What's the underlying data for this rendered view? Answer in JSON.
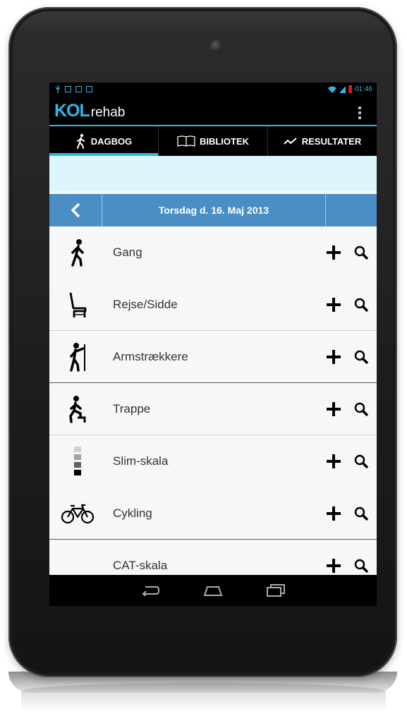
{
  "status_bar": {
    "time": "01:46"
  },
  "app": {
    "logo_primary": "KOL",
    "logo_secondary": "rehab"
  },
  "tabs": [
    {
      "label": "DAGBOG",
      "icon": "walking-person-icon",
      "active": true
    },
    {
      "label": "BIBLIOTEK",
      "icon": "book-icon",
      "active": false
    },
    {
      "label": "RESULTATER",
      "icon": "trend-line-icon",
      "active": false
    }
  ],
  "date_bar": {
    "date_label": "Torsdag d. 16. Maj 2013"
  },
  "activities": [
    {
      "label": "Gang",
      "icon": "walking-person-icon"
    },
    {
      "label": "Rejse/Sidde",
      "icon": "chair-icon"
    },
    {
      "label": "Armstrækkere",
      "icon": "arm-stretch-person-icon"
    },
    {
      "label": "Trappe",
      "icon": "stairs-person-icon"
    },
    {
      "label": "Slim-skala",
      "icon": "scale-bars-icon"
    },
    {
      "label": "Cykling",
      "icon": "bicycle-icon"
    },
    {
      "label": "CAT-skala",
      "icon": ""
    }
  ],
  "colors": {
    "accent": "#33b5e5",
    "date_bar": "#4a8ec5",
    "banner": "#ddf5fd"
  }
}
